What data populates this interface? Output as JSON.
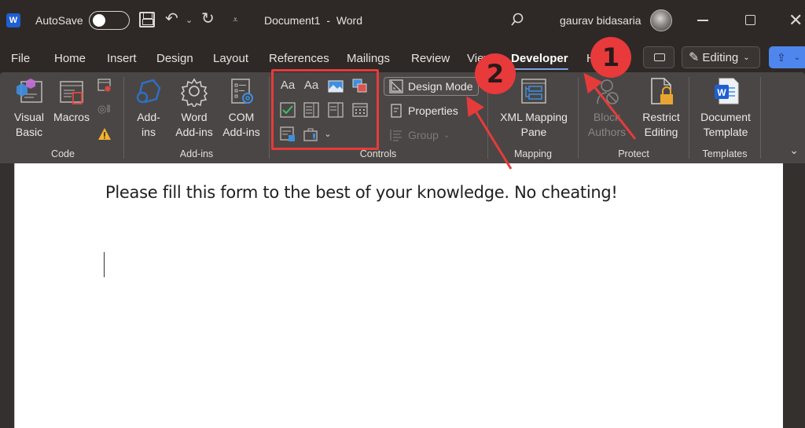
{
  "titlebar": {
    "app_icon": "word-logo-icon",
    "app_letter": "W",
    "autosave_label": "AutoSave",
    "autosave_state": "off",
    "document_title": "Document1  -  Word",
    "user_name": "gaurav bidasaria"
  },
  "tabs": [
    {
      "label": "File",
      "active": false
    },
    {
      "label": "Home",
      "active": false
    },
    {
      "label": "Insert",
      "active": false
    },
    {
      "label": "Design",
      "active": false
    },
    {
      "label": "Layout",
      "active": false
    },
    {
      "label": "References",
      "active": false
    },
    {
      "label": "Mailings",
      "active": false
    },
    {
      "label": "Review",
      "active": false
    },
    {
      "label": "View",
      "active": false
    },
    {
      "label": "Developer",
      "active": true
    },
    {
      "label": "Help",
      "active": false
    }
  ],
  "header_actions": {
    "editing_label": "Editing",
    "editing_icon": "pencil-icon",
    "share_icon": "share-icon",
    "accent_color": "#4f86ee"
  },
  "ribbon": {
    "groups": {
      "code": {
        "label": "Code",
        "visual_basic": "Visual Basic",
        "visual_basic_lines": [
          "Visual",
          "Basic"
        ],
        "macros": "Macros"
      },
      "addins": {
        "label": "Add-ins",
        "addins_lines": [
          "Add-",
          "ins"
        ],
        "word_addins_lines": [
          "Word",
          "Add-ins"
        ],
        "com_addins_lines": [
          "COM",
          "Add-ins"
        ]
      },
      "controls": {
        "label": "Controls",
        "rich_text": "Aa",
        "plain_text": "Aa",
        "design_mode": "Design Mode",
        "properties": "Properties",
        "group": "Group"
      },
      "mapping": {
        "label": "Mapping",
        "xml_lines": [
          "XML Mapping",
          "Pane"
        ]
      },
      "protect": {
        "label": "Protect",
        "block_lines": [
          "Block",
          "Authors"
        ],
        "restrict_lines": [
          "Restrict",
          "Editing"
        ]
      },
      "templates": {
        "label": "Templates",
        "template_lines": [
          "Document",
          "Template"
        ]
      }
    }
  },
  "document": {
    "text": "Please fill this form to the best of your knowledge. No cheating!"
  },
  "annotations": {
    "badge_1": "1",
    "badge_2": "2",
    "color": "#e63b3b"
  }
}
